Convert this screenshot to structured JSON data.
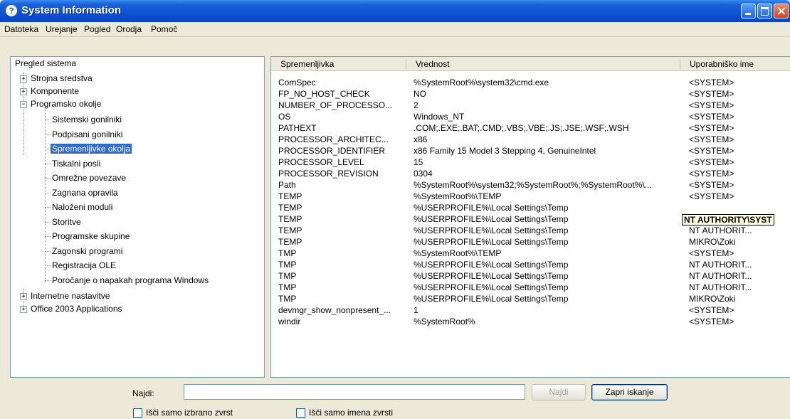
{
  "window": {
    "title": "System Information",
    "icon": "info-icon",
    "accent": "#0b4fd0"
  },
  "menu": [
    {
      "label": "Datoteka"
    },
    {
      "label": "Urejanje"
    },
    {
      "label": "Pogled"
    },
    {
      "label": "Orodja"
    },
    {
      "label": "Pomoč"
    }
  ],
  "tree": {
    "root": "Pregled sistema",
    "top": [
      {
        "label": "Strojna sredstva",
        "expander": "+"
      },
      {
        "label": "Komponente",
        "expander": "+"
      },
      {
        "label": "Programsko okolje",
        "expander": "−"
      },
      {
        "label": "Internetne nastavitve",
        "expander": "+"
      },
      {
        "label": "Office 2003 Applications",
        "expander": "+"
      }
    ],
    "children": [
      {
        "label": "Sistemski gonilniki"
      },
      {
        "label": "Podpisani gonilniki"
      },
      {
        "label": "Spremenljivke okolja",
        "selected": true
      },
      {
        "label": "Tiskalni posli"
      },
      {
        "label": "Omrežne povezave"
      },
      {
        "label": "Zagnana opravila"
      },
      {
        "label": "Naloženi moduli"
      },
      {
        "label": "Storitve"
      },
      {
        "label": "Programske skupine"
      },
      {
        "label": "Zagonski programi"
      },
      {
        "label": "Registracija OLE"
      },
      {
        "label": "Poročanje o napakah programa Windows"
      }
    ]
  },
  "table": {
    "columns": [
      "Spremenljivka",
      "Vrednost",
      "Uporabniško ime"
    ],
    "rows": [
      [
        "ComSpec",
        "%SystemRoot%\\system32\\cmd.exe",
        "<SYSTEM>"
      ],
      [
        "FP_NO_HOST_CHECK",
        "NO",
        "<SYSTEM>"
      ],
      [
        "NUMBER_OF_PROCESSO...",
        "2",
        "<SYSTEM>"
      ],
      [
        "OS",
        "Windows_NT",
        "<SYSTEM>"
      ],
      [
        "PATHEXT",
        ".COM;.EXE;.BAT;.CMD;.VBS;.VBE;.JS;.JSE;.WSF;.WSH",
        "<SYSTEM>"
      ],
      [
        "PROCESSOR_ARCHITEC...",
        "x86",
        "<SYSTEM>"
      ],
      [
        "PROCESSOR_IDENTIFIER",
        "x86 Family 15 Model 3 Stepping 4, GenuineIntel",
        "<SYSTEM>"
      ],
      [
        "PROCESSOR_LEVEL",
        "15",
        "<SYSTEM>"
      ],
      [
        "PROCESSOR_REVISION",
        "0304",
        "<SYSTEM>"
      ],
      [
        "Path",
        "%SystemRoot%\\system32;%SystemRoot%;%SystemRoot%\\...",
        "<SYSTEM>"
      ],
      [
        "TEMP",
        "%SystemRoot%\\TEMP",
        "<SYSTEM>"
      ],
      [
        "TEMP",
        "%USERPROFILE%\\Local Settings\\Temp",
        ""
      ],
      [
        "TEMP",
        "%USERPROFILE%\\Local Settings\\Temp",
        "NT AUTHORIT..."
      ],
      [
        "TEMP",
        "%USERPROFILE%\\Local Settings\\Temp",
        "NT AUTHORIT..."
      ],
      [
        "TEMP",
        "%USERPROFILE%\\Local Settings\\Temp",
        "MIKRO\\Zoki"
      ],
      [
        "TMP",
        "%SystemRoot%\\TEMP",
        "<SYSTEM>"
      ],
      [
        "TMP",
        "%USERPROFILE%\\Local Settings\\Temp",
        "NT AUTHORIT..."
      ],
      [
        "TMP",
        "%USERPROFILE%\\Local Settings\\Temp",
        "NT AUTHORIT..."
      ],
      [
        "TMP",
        "%USERPROFILE%\\Local Settings\\Temp",
        "NT AUTHORIT..."
      ],
      [
        "TMP",
        "%USERPROFILE%\\Local Settings\\Temp",
        "MIKRO\\Zoki"
      ],
      [
        "devmgr_show_nonpresent_...",
        "1",
        "<SYSTEM>"
      ],
      [
        "windir",
        "%SystemRoot%",
        "<SYSTEM>"
      ]
    ],
    "tooltip": "NT AUTHORITY\\SYST"
  },
  "search": {
    "label": "Najdi:",
    "value": "",
    "find_button": "Najdi",
    "close_button": "Zapri iskanje",
    "option1": "Išči samo izbrano zvrst",
    "option2": "Išči samo imena zvrsti"
  }
}
